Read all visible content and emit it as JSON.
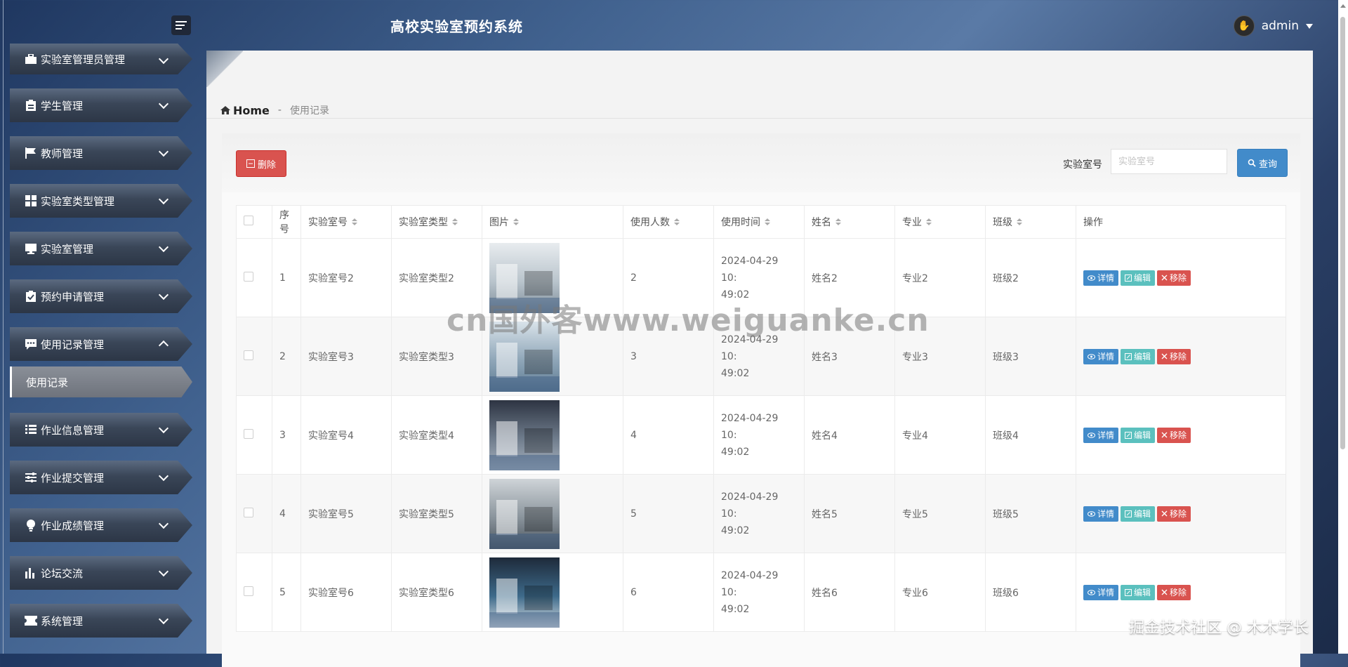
{
  "app": {
    "title": "高校实验室预约系统",
    "username": "admin"
  },
  "sidebar": {
    "items": [
      {
        "label": "实验室管理员管理",
        "icon": "briefcase-icon"
      },
      {
        "label": "学生管理",
        "icon": "clipboard-icon"
      },
      {
        "label": "教师管理",
        "icon": "flag-icon"
      },
      {
        "label": "实验室类型管理",
        "icon": "grid-icon"
      },
      {
        "label": "实验室管理",
        "icon": "monitor-icon"
      },
      {
        "label": "预约申请管理",
        "icon": "clipboard-check-icon"
      },
      {
        "label": "使用记录管理",
        "icon": "chat-icon",
        "expanded": true,
        "children": [
          {
            "label": "使用记录",
            "active": true
          }
        ]
      },
      {
        "label": "作业信息管理",
        "icon": "list-icon"
      },
      {
        "label": "作业提交管理",
        "icon": "sliders-icon"
      },
      {
        "label": "作业成绩管理",
        "icon": "bulb-icon"
      },
      {
        "label": "论坛交流",
        "icon": "bar-chart-icon"
      },
      {
        "label": "系统管理",
        "icon": "ticket-icon"
      }
    ]
  },
  "breadcrumb": {
    "home": "Home",
    "separator": "-",
    "current": "使用记录"
  },
  "toolbar": {
    "delete_label": "删除",
    "search_label": "实验室号",
    "search_placeholder": "实验室号",
    "search_button": "查询"
  },
  "table": {
    "headers": [
      "序号",
      "实验室号",
      "实验室类型",
      "图片",
      "使用人数",
      "使用时间",
      "姓名",
      "专业",
      "班级",
      "操作"
    ],
    "rows": [
      {
        "no": "1",
        "lab": "实验室号2",
        "type": "实验室类型2",
        "count": "2",
        "time1": "2024-04-29 10:",
        "time2": "49:02",
        "name": "姓名2",
        "major": "专业2",
        "class": "班级2"
      },
      {
        "no": "2",
        "lab": "实验室号3",
        "type": "实验室类型3",
        "count": "3",
        "time1": "2024-04-29 10:",
        "time2": "49:02",
        "name": "姓名3",
        "major": "专业3",
        "class": "班级3"
      },
      {
        "no": "3",
        "lab": "实验室号4",
        "type": "实验室类型4",
        "count": "4",
        "time1": "2024-04-29 10:",
        "time2": "49:02",
        "name": "姓名4",
        "major": "专业4",
        "class": "班级4"
      },
      {
        "no": "4",
        "lab": "实验室号5",
        "type": "实验室类型5",
        "count": "5",
        "time1": "2024-04-29 10:",
        "time2": "49:02",
        "name": "姓名5",
        "major": "专业5",
        "class": "班级5"
      },
      {
        "no": "5",
        "lab": "实验室号6",
        "type": "实验室类型6",
        "count": "6",
        "time1": "2024-04-29 10:",
        "time2": "49:02",
        "name": "姓名6",
        "major": "专业6",
        "class": "班级6"
      }
    ],
    "actions": {
      "detail": "详情",
      "edit": "编辑",
      "remove": "移除"
    }
  },
  "overlays": {
    "watermark": "cn国外客www.weiguanke.cn",
    "footer": "掘金技术社区 @ 木木学长"
  },
  "colors": {
    "danger": "#d9534f",
    "primary": "#428bca",
    "info": "#5bc0be"
  }
}
